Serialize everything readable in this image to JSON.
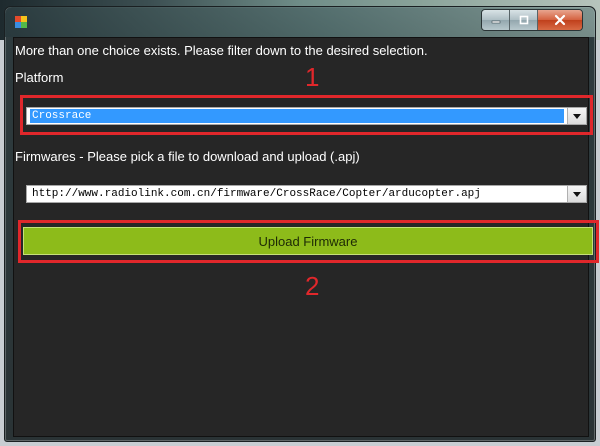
{
  "window": {
    "title": "",
    "icon": "app-icon",
    "controls": {
      "minimize": "minimize-icon",
      "maximize": "maximize-icon",
      "close": "close-icon"
    }
  },
  "dialog": {
    "message": "More than one choice exists. Please filter down to the desired selection.",
    "platform_label": "Platform",
    "platform_value": "Crossrace",
    "firmwares_label": "Firmwares - Please pick a file to download and upload (.apj)",
    "firmware_value": "http://www.radiolink.com.cn/firmware/CrossRace/Copter/arducopter.apj",
    "upload_label": "Upload Firmware"
  },
  "annotations": {
    "step1": "1",
    "step2": "2",
    "color": "#e0272b"
  },
  "colors": {
    "selection": "#3399ff",
    "button": "#8dbb1a",
    "background": "#262626"
  }
}
